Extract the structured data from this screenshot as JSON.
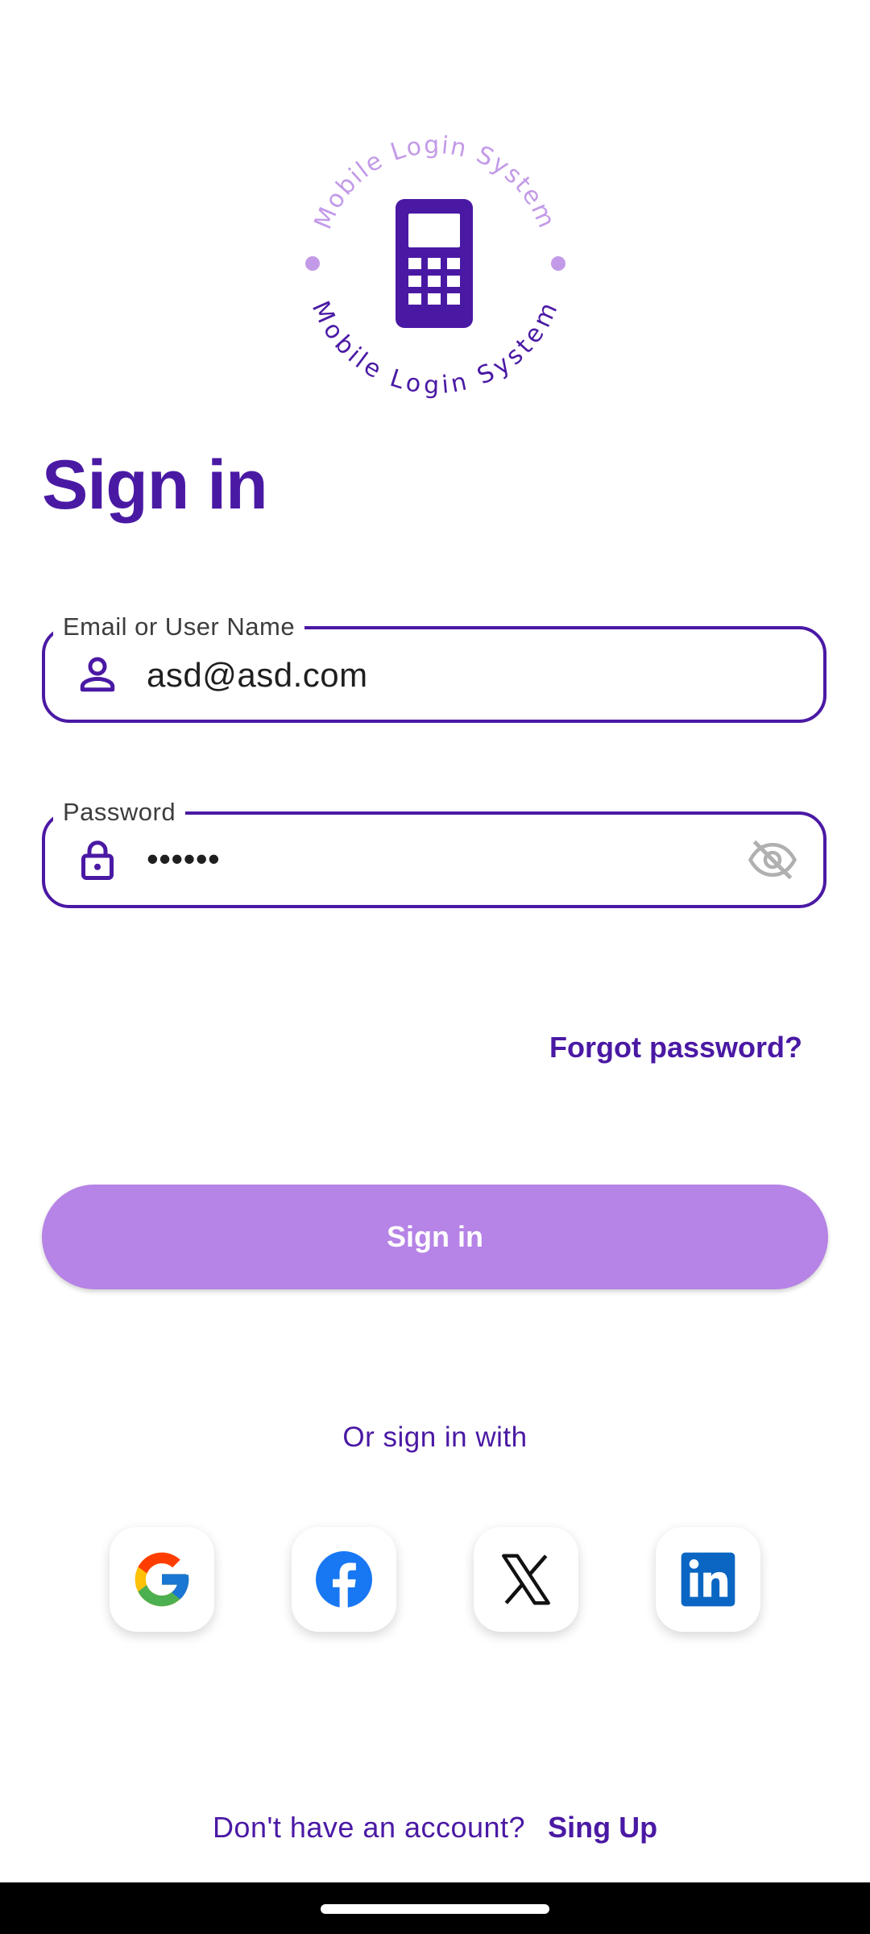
{
  "logo": {
    "ring_text_top": "Mobile Login System",
    "ring_text_bottom": "Mobile Login System",
    "icon": "phone-icon"
  },
  "title": "Sign in",
  "email_field": {
    "label": "Email or User Name",
    "value": "asd@asd.com",
    "icon": "person-icon"
  },
  "password_field": {
    "label": "Password",
    "value": "••••••",
    "icon": "lock-icon",
    "toggle_icon": "eye-off-icon"
  },
  "forgot_label": "Forgot password?",
  "signin_button_label": "Sign in",
  "or_label": "Or sign in with",
  "social": [
    "google-icon",
    "facebook-icon",
    "x-icon",
    "linkedin-icon"
  ],
  "signup": {
    "prompt": "Don't have an account?",
    "link": "Sing Up"
  },
  "colors": {
    "primary": "#4a19a4",
    "button": "#b683e6",
    "logo_ring": "#c39ae8"
  }
}
